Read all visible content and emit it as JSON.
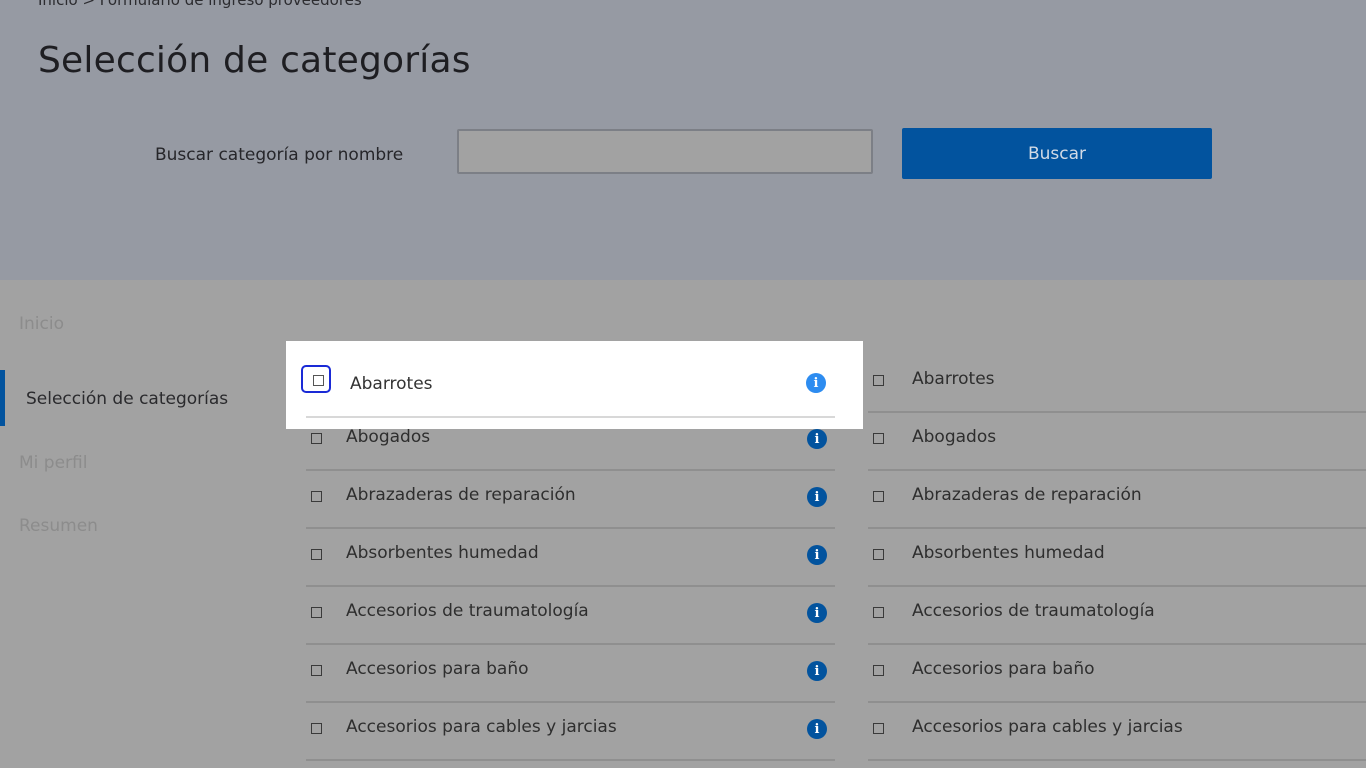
{
  "breadcrumb": {
    "text": "Inicio > Formulario de ingreso proveedores"
  },
  "page": {
    "title": "Selección de categorías"
  },
  "search": {
    "label": "Buscar categoría por nombre",
    "value": "",
    "placeholder": "",
    "button_label": "Buscar"
  },
  "sidebar": {
    "items": [
      {
        "label": "Inicio",
        "active": false
      },
      {
        "label": "Selección de categorías",
        "active": true
      },
      {
        "label": "Mi perfil",
        "active": false
      },
      {
        "label": "Resumen",
        "active": false
      }
    ]
  },
  "categories": {
    "left": [
      "Abarrotes",
      "Abogados",
      "Abrazaderas de reparación",
      "Absorbentes humedad",
      "Accesorios de traumatología",
      "Accesorios para baño",
      "Accesorios para cables y jarcias"
    ],
    "right": [
      "Abarrotes",
      "Abogados",
      "Abrazaderas de reparación",
      "Absorbentes humedad",
      "Accesorios de traumatología",
      "Accesorios para baño",
      "Accesorios para cables y jarcias"
    ]
  },
  "highlight": {
    "label": "Abarrotes"
  },
  "icons": {
    "info": "info-icon",
    "info_glyph": "i",
    "checkbox": "checkbox-icon"
  },
  "colors": {
    "brand_blue": "#02539e",
    "info_blue_active": "#2d8cf0",
    "focus_outline": "#1a2ad6",
    "overlay_header": "#969aa3",
    "overlay_body": "#a2a2a2"
  }
}
